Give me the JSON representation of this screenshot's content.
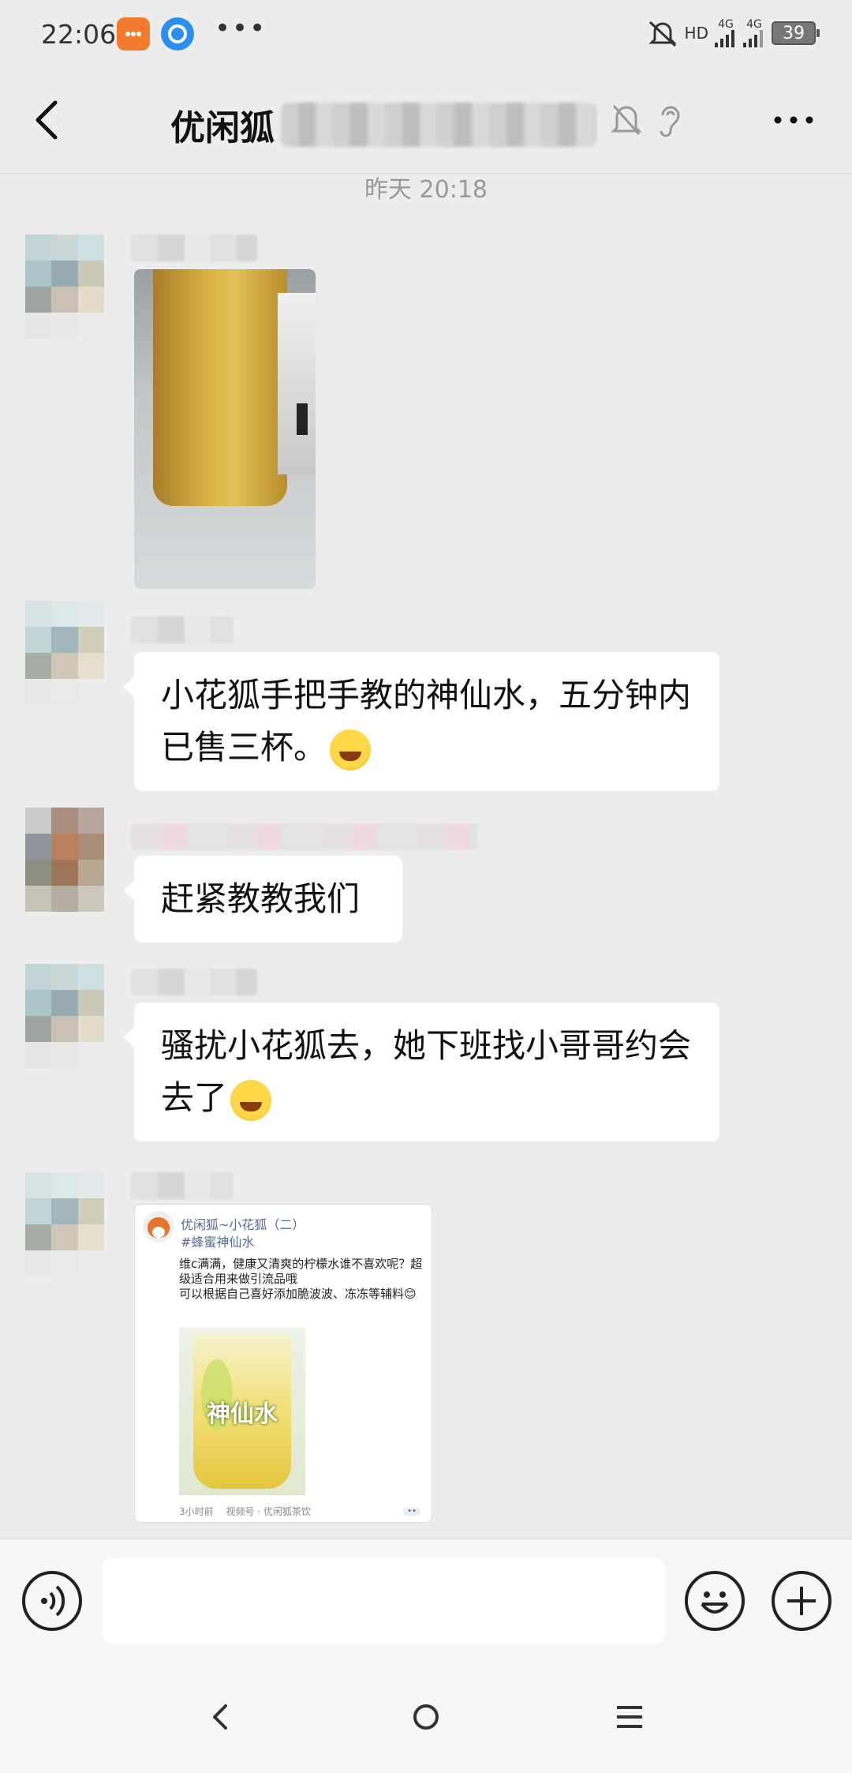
{
  "status_bar": {
    "time": "22:06",
    "network": "HD",
    "signal_1": "4G",
    "signal_2": "4G",
    "battery": "39",
    "dots": "•••"
  },
  "header": {
    "title": "优闲狐",
    "back_icon": "chevron-left-icon",
    "mute_icon": "bell-off-icon",
    "ear_icon": "ear-icon",
    "more_icon": "more-horizontal-icon"
  },
  "chat": {
    "timestamp": "昨天 20:18",
    "messages": [
      {
        "type": "image",
        "description_icon": "photo"
      },
      {
        "type": "text",
        "text": "小花狐手把手教的神仙水，五分钟内已售三杯。"
      },
      {
        "type": "text",
        "text": "赶紧教教我们"
      },
      {
        "type": "text",
        "text": "骚扰小花狐去，她下班找小哥哥约会去了"
      },
      {
        "type": "share_card",
        "author": "优闲狐~小花狐（二）",
        "topic": "#蜂蜜神仙水",
        "body": "维c满满，健康又清爽的柠檬水谁不喜欢呢？超级适合用来做引流品哦\n可以根据自己喜好添加脆波波、冻冻等辅料😊",
        "image_overlay": "神仙水",
        "time_ago": "3小时前",
        "source": "视频号 · 优闲狐茶饮"
      }
    ]
  },
  "input_bar": {
    "placeholder": "",
    "voice_icon": "voice-icon",
    "emoji_icon": "emoji-icon",
    "plus_icon": "plus-icon"
  },
  "nav_bar": {
    "back_icon": "nav-back-icon",
    "home_icon": "nav-home-icon",
    "menu_icon": "nav-menu-icon"
  },
  "colors": {
    "background": "#ededed",
    "bubble": "#ffffff",
    "link": "#576b95",
    "notification": "#f27b2d",
    "accent_ring": "#2b8ff0"
  }
}
